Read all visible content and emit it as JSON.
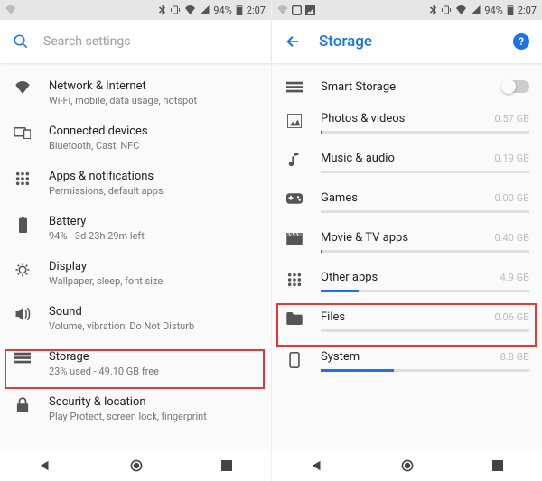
{
  "status": {
    "battery": "94%",
    "time": "2:07"
  },
  "left": {
    "search_placeholder": "Search settings",
    "items": [
      {
        "title": "Network & Internet",
        "sub": "Wi-Fi, mobile, data usage, hotspot"
      },
      {
        "title": "Connected devices",
        "sub": "Bluetooth, Cast, NFC"
      },
      {
        "title": "Apps & notifications",
        "sub": "Permissions, default apps"
      },
      {
        "title": "Battery",
        "sub": "94% - 3d 23h 29m left"
      },
      {
        "title": "Display",
        "sub": "Wallpaper, sleep, font size"
      },
      {
        "title": "Sound",
        "sub": "Volume, vibration, Do Not Disturb"
      },
      {
        "title": "Storage",
        "sub": "23% used - 49.10 GB free"
      },
      {
        "title": "Security & location",
        "sub": "Play Protect, screen lock, fingerprint"
      }
    ]
  },
  "right": {
    "title": "Storage",
    "smart_storage": "Smart Storage",
    "items": [
      {
        "title": "Photos & videos",
        "size": "0.57 GB",
        "pct": 1
      },
      {
        "title": "Music & audio",
        "size": "0.19 GB",
        "pct": 0
      },
      {
        "title": "Games",
        "size": "0.00 GB",
        "pct": 0
      },
      {
        "title": "Movie & TV apps",
        "size": "0.40 GB",
        "pct": 1
      },
      {
        "title": "Other apps",
        "size": "4.9 GB",
        "pct": 18
      },
      {
        "title": "Files",
        "size": "0.06 GB",
        "pct": 0
      },
      {
        "title": "System",
        "size": "8.8 GB",
        "pct": 35
      }
    ]
  }
}
